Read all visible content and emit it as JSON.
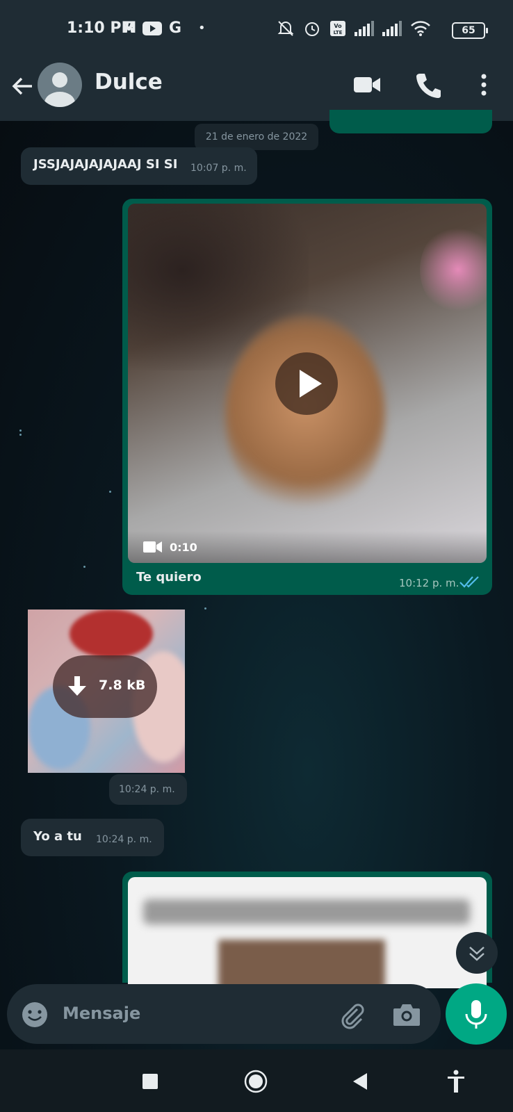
{
  "status_bar": {
    "time": "1:10 PM",
    "battery": "65"
  },
  "header": {
    "contact_name": "Dulce"
  },
  "chat": {
    "date_chip": "21 de enero de 2022",
    "messages": [
      {
        "type": "incoming-text",
        "text": "JSSJAJAJAJAJAAJ SI SI",
        "time": "10:07 p. m."
      },
      {
        "type": "outgoing-video",
        "duration": "0:10",
        "caption": "Te quiero",
        "time": "10:12 p. m.",
        "status": "read"
      },
      {
        "type": "incoming-sticker",
        "size": "7.8 kB",
        "time": "10:24 p. m."
      },
      {
        "type": "incoming-text",
        "text": "Yo a tu",
        "time": "10:24 p. m."
      }
    ]
  },
  "input": {
    "placeholder": "Mensaje"
  },
  "colors": {
    "header_bg": "#1f2c34",
    "incoming_bubble": "#1f2c34",
    "outgoing_bubble": "#005c4b",
    "accent": "#00a884",
    "read_ticks": "#53bdeb"
  },
  "icons": [
    "back-arrow-icon",
    "avatar-icon",
    "video-call-icon",
    "phone-icon",
    "more-vert-icon",
    "play-icon",
    "video-camera-icon",
    "double-check-icon",
    "download-icon",
    "scroll-down-icon",
    "emoji-icon",
    "attach-icon",
    "camera-icon",
    "mic-icon",
    "nav-recents-icon",
    "nav-home-icon",
    "nav-back-icon",
    "accessibility-icon"
  ]
}
